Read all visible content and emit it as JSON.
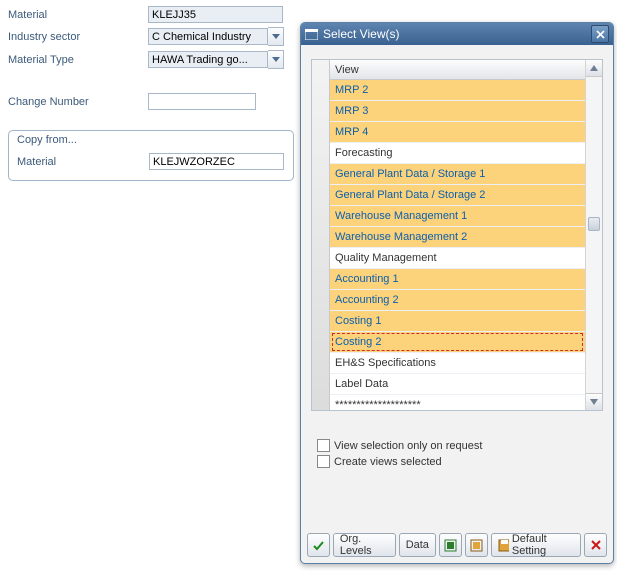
{
  "form": {
    "material_label": "Material",
    "material_value": "KLEJJ35",
    "industry_label": "Industry sector",
    "industry_value": "C Chemical Industry",
    "mattype_label": "Material Type",
    "mattype_value": "HAWA Trading go...",
    "change_label": "Change Number",
    "change_value": ""
  },
  "copyfrom": {
    "title": "Copy from...",
    "material_label": "Material",
    "material_value": "KLEJWZORZEC"
  },
  "dialog": {
    "title": "Select View(s)",
    "list_header": "View",
    "rows": [
      {
        "label": "MRP 2",
        "selected": true
      },
      {
        "label": "MRP 3",
        "selected": true
      },
      {
        "label": "MRP 4",
        "selected": true
      },
      {
        "label": "Forecasting",
        "selected": false
      },
      {
        "label": "General Plant Data / Storage 1",
        "selected": true
      },
      {
        "label": "General Plant Data / Storage 2",
        "selected": true
      },
      {
        "label": "Warehouse Management 1",
        "selected": true
      },
      {
        "label": "Warehouse Management 2",
        "selected": true
      },
      {
        "label": "Quality Management",
        "selected": false
      },
      {
        "label": "Accounting 1",
        "selected": true
      },
      {
        "label": "Accounting 2",
        "selected": true
      },
      {
        "label": "Costing 1",
        "selected": true
      },
      {
        "label": "Costing 2",
        "selected": true,
        "focused": true
      },
      {
        "label": "EH&S Specifications",
        "selected": false
      },
      {
        "label": "Label Data",
        "selected": false
      },
      {
        "label": "********************",
        "selected": false
      }
    ],
    "chk1": "View selection only on request",
    "chk2": "Create views selected",
    "buttons": {
      "org": "Org. Levels",
      "data": "Data",
      "default": "Default Setting"
    }
  }
}
